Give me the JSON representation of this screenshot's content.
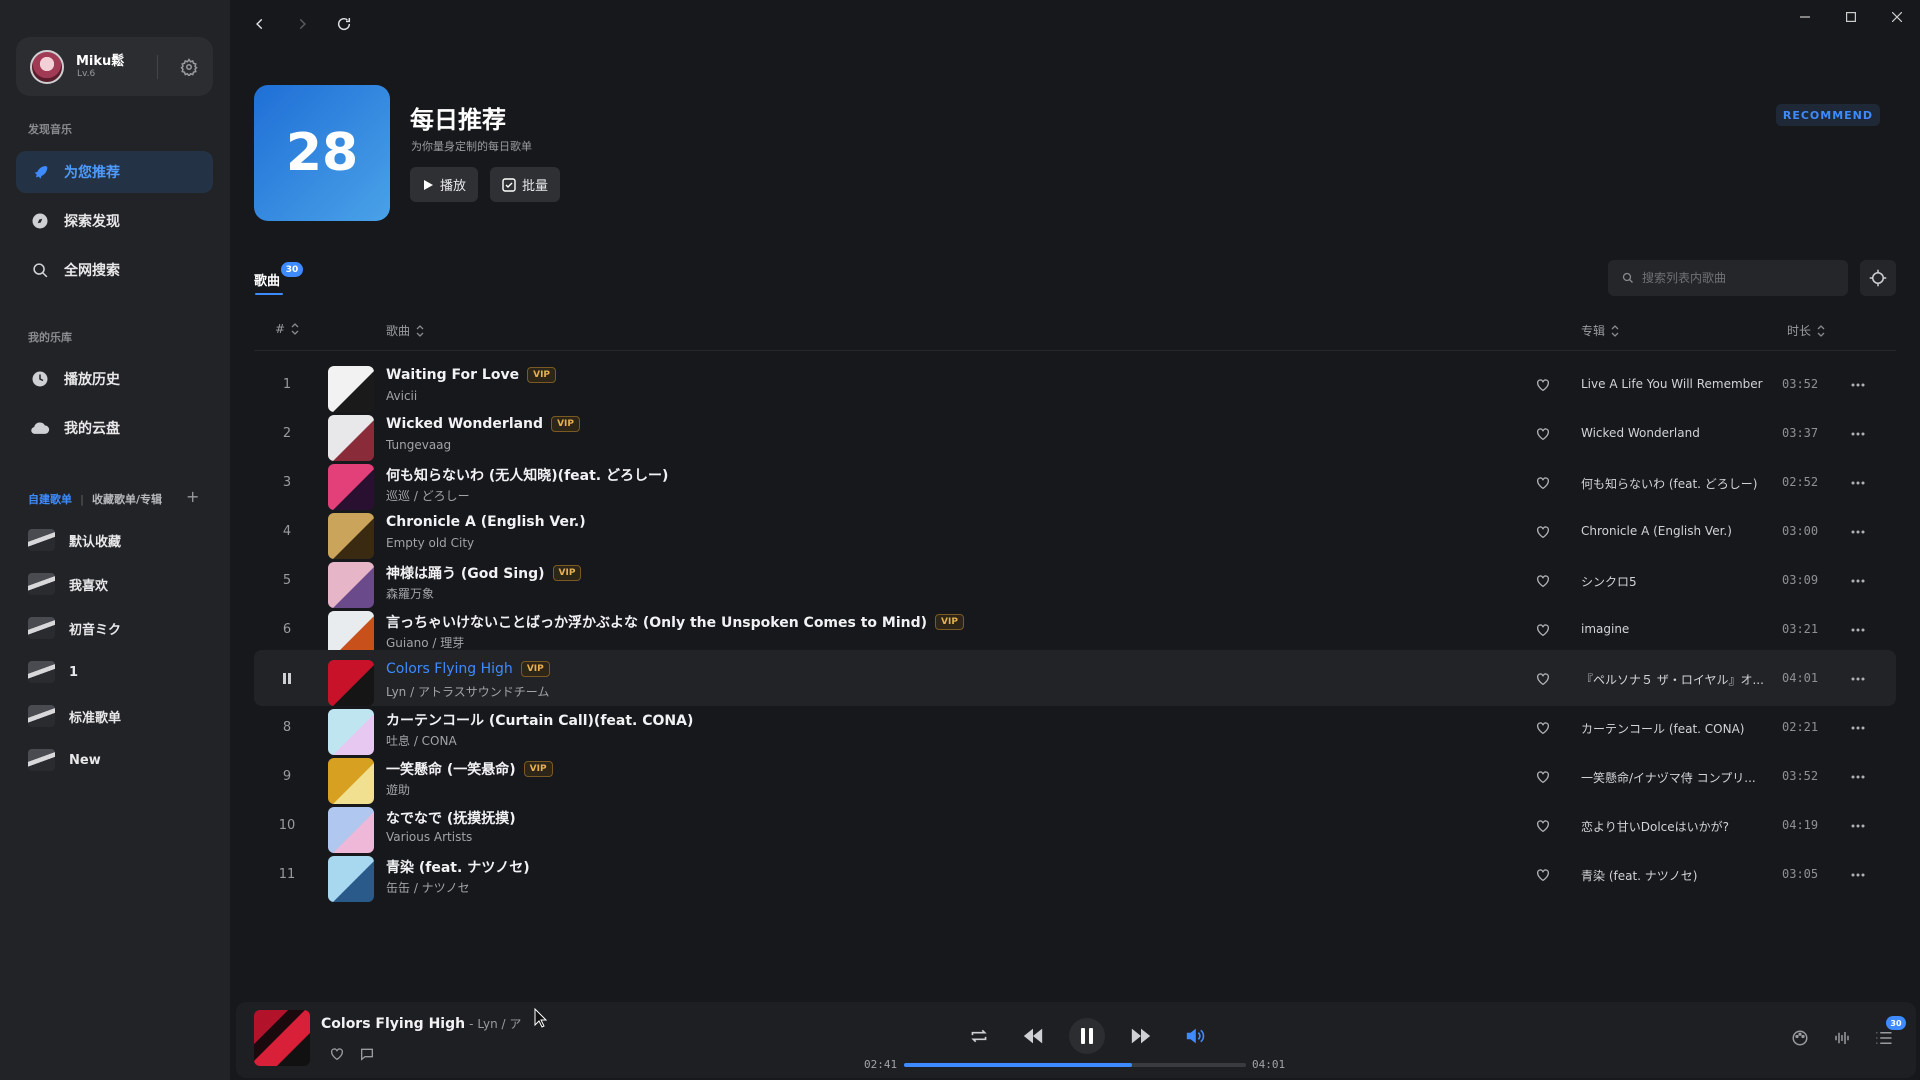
{
  "user": {
    "name": "Miku鬆",
    "level": "Lv.6"
  },
  "sidebar": {
    "discover_label": "发现音乐",
    "nav": [
      {
        "label": "为您推荐",
        "icon": "rocket-icon",
        "active": true
      },
      {
        "label": "探索发现",
        "icon": "compass-icon",
        "active": false
      },
      {
        "label": "全网搜索",
        "icon": "search-icon",
        "active": false
      }
    ],
    "library_label": "我的乐库",
    "library": [
      {
        "label": "播放历史",
        "icon": "clock-icon"
      },
      {
        "label": "我的云盘",
        "icon": "cloud-icon"
      }
    ],
    "playlist_tabs": {
      "created": "自建歌单",
      "divider": "|",
      "collected": "收藏歌单/专辑",
      "add": "+"
    },
    "playlists": [
      "默认收藏",
      "我喜欢",
      "初音ミク",
      "1",
      "标准歌单",
      "New"
    ]
  },
  "hero": {
    "day": "28",
    "title": "每日推荐",
    "subtitle": "为你量身定制的每日歌单",
    "play_label": "播放",
    "batch_label": "批量",
    "badge": "RECOMMEND"
  },
  "tabs": {
    "songs_label": "歌曲",
    "songs_count": "30"
  },
  "search": {
    "placeholder": "搜索列表内歌曲"
  },
  "table": {
    "headers": {
      "index": "#",
      "title": "歌曲",
      "album": "专辑",
      "duration": "时长"
    },
    "rows": [
      {
        "idx": "1",
        "title": "Waiting For Love",
        "vip": "VIP",
        "artist": "Avicii",
        "album": "Live A Life You Will Remember",
        "dur": "03:52"
      },
      {
        "idx": "2",
        "title": "Wicked Wonderland",
        "vip": "VIP",
        "artist": "Tungevaag",
        "album": "Wicked Wonderland",
        "dur": "03:37"
      },
      {
        "idx": "3",
        "title": "何も知らないわ (无人知晓)(feat. どろしー)",
        "vip": "",
        "artist": "巡巡 / どろしー",
        "album": "何も知らないわ (feat. どろしー)",
        "dur": "02:52"
      },
      {
        "idx": "4",
        "title": "Chronicle A (English Ver.)",
        "vip": "",
        "artist": "Empty old City",
        "album": "Chronicle A (English Ver.)",
        "dur": "03:00"
      },
      {
        "idx": "5",
        "title": "神様は踊う (God Sing)",
        "vip": "VIP",
        "artist": "森羅万象",
        "album": "シンクロ5",
        "dur": "03:09"
      },
      {
        "idx": "6",
        "title": "言っちゃいけないことばっか浮かぶよな (Only the Unspoken Comes to Mind)",
        "vip": "VIP",
        "artist": "Guiano / 理芽",
        "album": "imagine",
        "dur": "03:21"
      },
      {
        "idx": "",
        "title": "Colors Flying High",
        "vip": "VIP",
        "artist": "Lyn / アトラスサウンドチーム",
        "album": "『ペルソナ５ ザ・ロイヤル』オ...",
        "dur": "04:01",
        "playing": true
      },
      {
        "idx": "8",
        "title": "カーテンコール (Curtain Call)(feat. CONA)",
        "vip": "",
        "artist": "吐息 / CONA",
        "album": "カーテンコール (feat. CONA)",
        "dur": "02:21"
      },
      {
        "idx": "9",
        "title": "一笑懸命 (一笑悬命)",
        "vip": "VIP",
        "artist": "遊助",
        "album": "一笑懸命/イナヅマ侍 コンプリ...",
        "dur": "03:52"
      },
      {
        "idx": "10",
        "title": "なでなで (抚摸抚摸)",
        "vip": "",
        "artist": "Various Artists",
        "album": "恋より甘いDolceはいかが?",
        "dur": "04:19"
      },
      {
        "idx": "11",
        "title": "青染 (feat. ナツノセ)",
        "vip": "",
        "artist": "缶缶 / ナツノセ",
        "album": "青染 (feat. ナツノセ)",
        "dur": "03:05"
      }
    ]
  },
  "player": {
    "title": "Colors Flying High",
    "sep": "-",
    "artist": "Lyn / ア",
    "current_time": "02:41",
    "total_time": "04:01",
    "progress": 0.668,
    "queue_count": "30"
  },
  "colors": {
    "accent": "#3d8bff",
    "vip": "#e6b050",
    "background": "#17181b",
    "sidebar": "#222326"
  }
}
